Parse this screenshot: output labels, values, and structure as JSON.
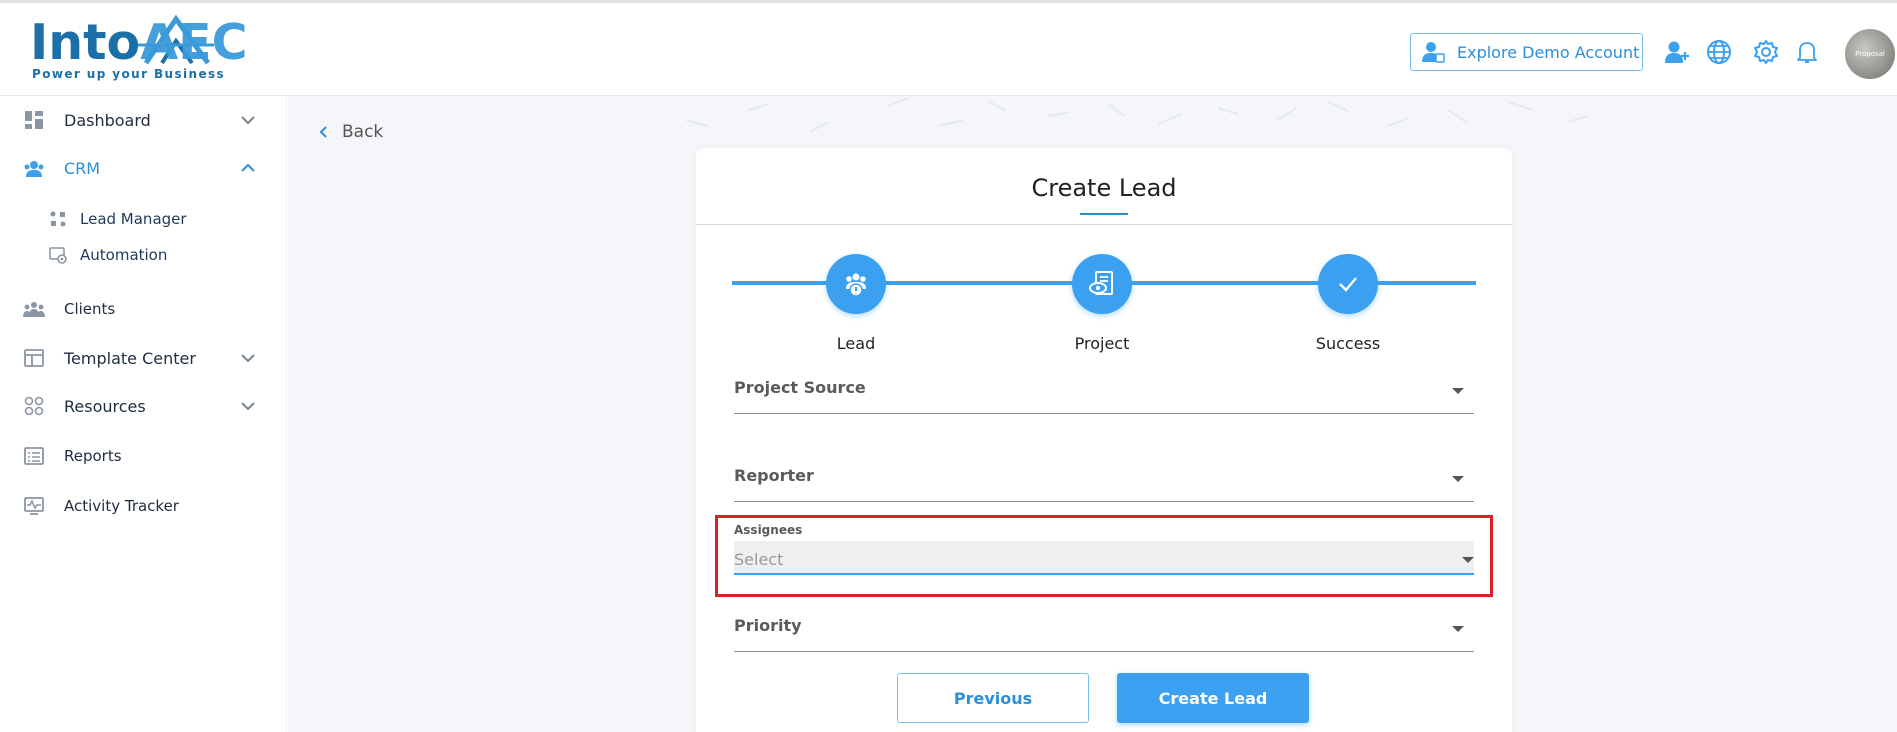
{
  "header": {
    "logo": {
      "brand_main": "Into",
      "brand_accent": "AEC",
      "tagline": "Power up your Business"
    },
    "demo_button_label": "Explore Demo Account",
    "icons": [
      "add-user-icon",
      "globe-icon",
      "gear-icon",
      "bell-icon"
    ],
    "avatar_text": "Proposal"
  },
  "sidebar": {
    "items": [
      {
        "label": "Dashboard",
        "icon": "dashboard-icon",
        "expandable": true,
        "expanded": false
      },
      {
        "label": "CRM",
        "icon": "crm-icon",
        "expandable": true,
        "expanded": true,
        "active": true
      },
      {
        "label": "Clients",
        "icon": "clients-icon",
        "expandable": false
      },
      {
        "label": "Template Center",
        "icon": "template-icon",
        "expandable": true,
        "expanded": false
      },
      {
        "label": "Resources",
        "icon": "resources-icon",
        "expandable": true,
        "expanded": false
      },
      {
        "label": "Reports",
        "icon": "reports-icon",
        "expandable": false
      },
      {
        "label": "Activity Tracker",
        "icon": "activity-icon",
        "expandable": false
      }
    ],
    "crm_subitems": [
      {
        "label": "Lead Manager",
        "icon": "lead-manager-icon"
      },
      {
        "label": "Automation",
        "icon": "automation-icon"
      }
    ]
  },
  "main": {
    "back_label": "Back",
    "card": {
      "title": "Create Lead",
      "steps": [
        {
          "label": "Lead",
          "icon": "lead-step-icon"
        },
        {
          "label": "Project",
          "icon": "project-step-icon"
        },
        {
          "label": "Success",
          "icon": "check-icon"
        }
      ],
      "fields": {
        "project_source": {
          "label": "Project Source"
        },
        "reporter": {
          "label": "Reporter"
        },
        "assignees": {
          "label": "Assignees",
          "placeholder": "Select"
        },
        "priority": {
          "label": "Priority"
        }
      },
      "buttons": {
        "previous": "Previous",
        "create": "Create Lead"
      }
    }
  },
  "colors": {
    "accent": "#3aa0ef",
    "brand": "#1d6fa8",
    "highlight": "#d9222a"
  }
}
